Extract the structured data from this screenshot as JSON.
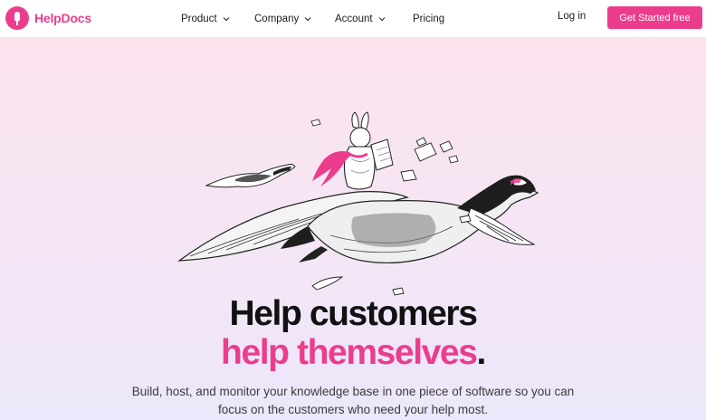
{
  "brand": {
    "name": "HelpDocs",
    "accent": "#ec3d8d",
    "logo_icon": "helpdocs-logo-icon"
  },
  "nav": {
    "items": [
      {
        "label": "Product",
        "has_dropdown": true
      },
      {
        "label": "Company",
        "has_dropdown": true
      },
      {
        "label": "Account",
        "has_dropdown": true
      },
      {
        "label": "Pricing",
        "has_dropdown": false
      }
    ],
    "login": "Log in",
    "cta": "Get Started free"
  },
  "hero": {
    "illustration": "rabbit-riding-goose-illustration",
    "headline_line1": "Help customers",
    "headline_line2": "help themselves",
    "headline_period": ".",
    "subtitle": "Build, host, and monitor your knowledge base in one piece of software so you can focus on the customers who need your help most."
  }
}
